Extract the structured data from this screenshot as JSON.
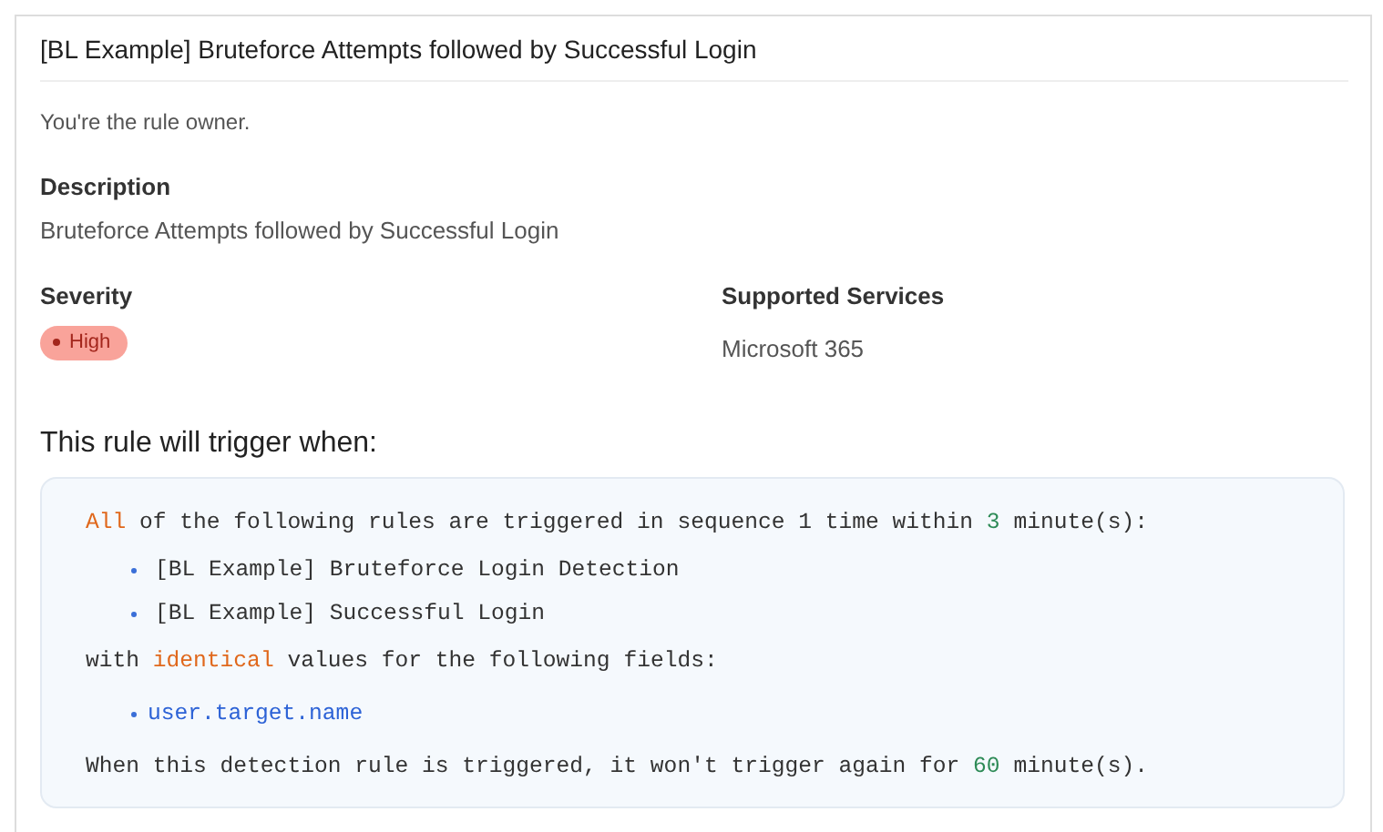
{
  "title": "[BL Example] Bruteforce Attempts followed by Successful Login",
  "ownership": "You're the rule owner.",
  "description": {
    "label": "Description",
    "text": "Bruteforce Attempts followed by Successful Login"
  },
  "severity": {
    "label": "Severity",
    "value": "High",
    "kind": "high"
  },
  "supported_services": {
    "label": "Supported Services",
    "value": "Microsoft 365"
  },
  "trigger": {
    "heading": "This rule will trigger when:",
    "lines": [
      {
        "kind": "sentence",
        "segments": [
          {
            "kind": "keyword",
            "text": "All"
          },
          {
            "kind": "plain",
            "text": " of the following rules are triggered in sequence 1 time within "
          },
          {
            "kind": "number",
            "text": "3"
          },
          {
            "kind": "plain",
            "text": " minute(s):"
          }
        ]
      },
      {
        "kind": "bullet",
        "segments": [
          {
            "kind": "plain",
            "text": "[BL Example] Bruteforce Login Detection"
          }
        ]
      },
      {
        "kind": "bullet",
        "segments": [
          {
            "kind": "plain",
            "text": "[BL Example] Successful Login"
          }
        ]
      },
      {
        "kind": "sentence",
        "segments": [
          {
            "kind": "plain",
            "text": "with "
          },
          {
            "kind": "keyword",
            "text": "identical"
          },
          {
            "kind": "plain",
            "text": " values for the following fields:"
          }
        ]
      },
      {
        "kind": "field",
        "segments": [
          {
            "kind": "link",
            "text": "user.target.name"
          }
        ]
      },
      {
        "kind": "sentence",
        "segments": [
          {
            "kind": "plain",
            "text": "When this detection rule is triggered, it won't trigger again for "
          },
          {
            "kind": "number",
            "text": "60"
          },
          {
            "kind": "plain",
            "text": " minute(s)."
          }
        ]
      }
    ]
  }
}
